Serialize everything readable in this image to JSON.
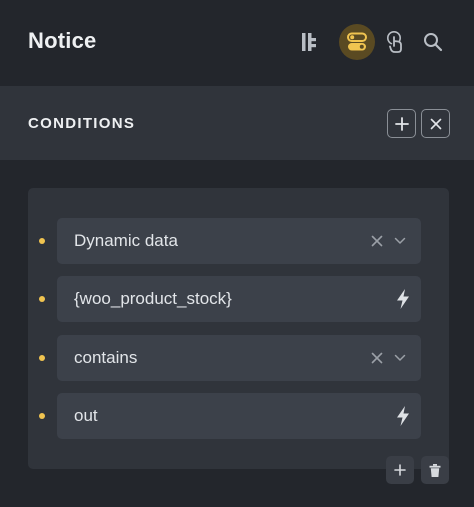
{
  "header": {
    "title": "Notice"
  },
  "conditions": {
    "title": "CONDITIONS",
    "rows": [
      {
        "value": "Dynamic data"
      },
      {
        "value": "{woo_product_stock}"
      },
      {
        "value": "contains"
      },
      {
        "value": "out"
      }
    ]
  },
  "colors": {
    "accent": "#f0c450",
    "background": "#23262c",
    "panel": "#30343b",
    "field": "#3c414a"
  }
}
